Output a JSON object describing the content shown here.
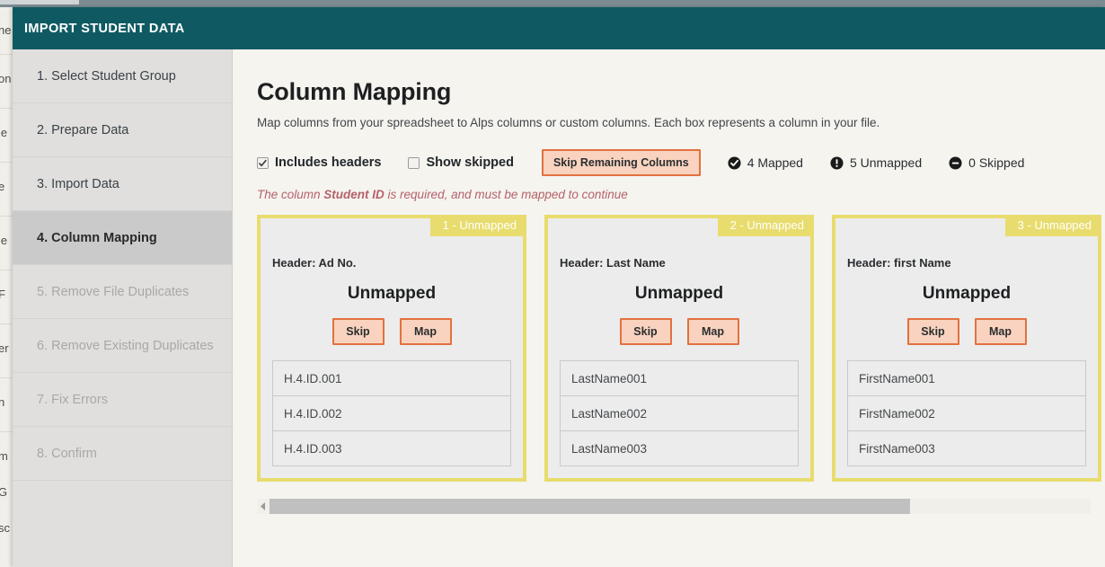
{
  "modal": {
    "title": "IMPORT STUDENT DATA"
  },
  "sidebar": {
    "items": [
      {
        "label": "1. Select Student Group",
        "state": "done"
      },
      {
        "label": "2. Prepare Data",
        "state": "done"
      },
      {
        "label": "3. Import Data",
        "state": "done"
      },
      {
        "label": "4. Column Mapping",
        "state": "active"
      },
      {
        "label": "5. Remove File Duplicates",
        "state": "disabled"
      },
      {
        "label": "6. Remove Existing Duplicates",
        "state": "disabled"
      },
      {
        "label": "7. Fix Errors",
        "state": "disabled"
      },
      {
        "label": "8. Confirm",
        "state": "disabled"
      }
    ]
  },
  "main": {
    "heading": "Column Mapping",
    "subheading": "Map columns from your spreadsheet to Alps columns or custom columns. Each box represents a column in your file.",
    "toolbar": {
      "includes_headers_label": "Includes headers",
      "includes_headers_checked": true,
      "show_skipped_label": "Show skipped",
      "show_skipped_checked": false,
      "skip_remaining_label": "Skip Remaining Columns",
      "stats": [
        {
          "icon": "check-circle-icon",
          "label": "4 Mapped"
        },
        {
          "icon": "exclamation-circle-icon",
          "label": "5 Unmapped"
        },
        {
          "icon": "minus-circle-icon",
          "label": "0 Skipped"
        }
      ]
    },
    "warning": {
      "prefix": "The column ",
      "column_name": "Student ID",
      "suffix": " is required, and must be mapped to continue"
    },
    "cards": [
      {
        "badge": "1 - Unmapped",
        "header_label": "Header: Ad No.",
        "status": "Unmapped",
        "skip_label": "Skip",
        "map_label": "Map",
        "samples": [
          "H.4.ID.001",
          "H.4.ID.002",
          "H.4.ID.003"
        ]
      },
      {
        "badge": "2 - Unmapped",
        "header_label": "Header: Last Name",
        "status": "Unmapped",
        "skip_label": "Skip",
        "map_label": "Map",
        "samples": [
          "LastName001",
          "LastName002",
          "LastName003"
        ]
      },
      {
        "badge": "3 - Unmapped",
        "header_label": "Header: first Name",
        "status": "Unmapped",
        "skip_label": "Skip",
        "map_label": "Map",
        "samples": [
          "FirstName001",
          "FirstName002",
          "FirstName003"
        ]
      }
    ]
  },
  "colors": {
    "titlebar_teal": "#0f5a62",
    "card_border_yellow": "#e8dc6e",
    "button_orange_border": "#e2713f",
    "button_peach_fill": "#f9d3bf",
    "warning_red": "#b5616a",
    "sidebar_bg": "#e0dfdd",
    "sidebar_active_bg": "#cbcaca",
    "page_bg": "#f5f4ef"
  }
}
